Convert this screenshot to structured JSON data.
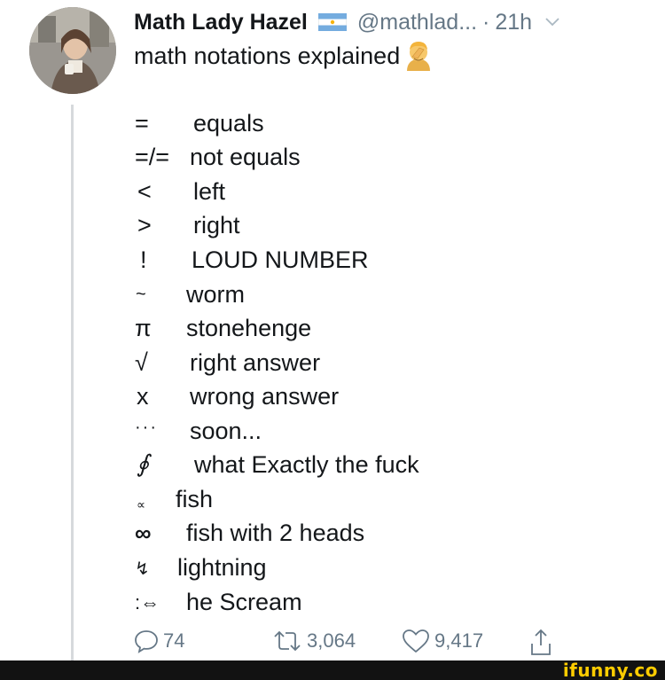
{
  "tweet": {
    "author_name": "Math Lady Hazel",
    "handle": "@mathlad...",
    "separator": "·",
    "time": "21h",
    "text": "math notations explained",
    "flag_icon": "argentina-flag-icon",
    "emoji_icon": "facepalm-emoji-icon"
  },
  "notations": [
    {
      "symbol": "=",
      "meaning": "equals"
    },
    {
      "symbol": "=/=",
      "meaning": "not equals"
    },
    {
      "symbol": "<",
      "meaning": "left"
    },
    {
      "symbol": ">",
      "meaning": "right"
    },
    {
      "symbol": "!",
      "meaning": "LOUD NUMBER"
    },
    {
      "symbol": "~",
      "meaning": "worm"
    },
    {
      "symbol": "π",
      "meaning": "stonehenge"
    },
    {
      "symbol": "√",
      "meaning": "right answer"
    },
    {
      "symbol": "x",
      "meaning": "wrong answer"
    },
    {
      "symbol": "···",
      "meaning": "soon..."
    },
    {
      "symbol": "∮",
      "meaning": "what Exactly the fuck"
    },
    {
      "symbol": "∝",
      "meaning": "fish"
    },
    {
      "symbol": "∞",
      "meaning": "fish with 2 heads"
    },
    {
      "symbol": "↯",
      "meaning": "lightning"
    },
    {
      "symbol": ":⇔",
      "meaning": "he Scream"
    }
  ],
  "actions": {
    "replies": "74",
    "retweets": "3,064",
    "likes": "9,417"
  },
  "watermark": {
    "text": "ifunny.co"
  },
  "colors": {
    "text": "#14171a",
    "secondary": "#657786",
    "thread_line": "#d6d9dc",
    "watermark_yellow": "#ffcc00"
  }
}
